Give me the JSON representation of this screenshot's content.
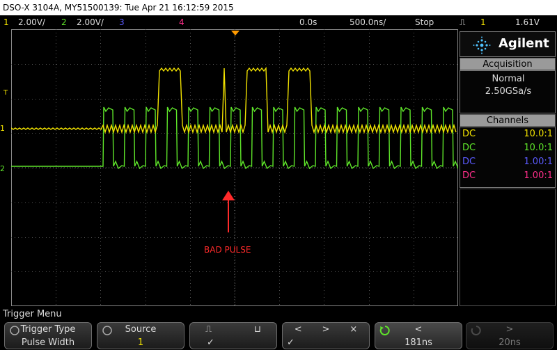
{
  "title_bar": "DSO-X 3104A, MY51500139: Tue Apr 21 16:12:59 2015",
  "status": {
    "ch1_num": "1",
    "ch1_scale": "2.00V/",
    "ch2_num": "2",
    "ch2_scale": "2.00V/",
    "ch3_num": "3",
    "ch4_num": "4",
    "delay": "0.0s",
    "timebase": "500.0ns/",
    "run_state": "Stop",
    "trig_src": "1",
    "trig_level": "1.61V"
  },
  "brand": "Agilent",
  "acquisition": {
    "title": "Acquisition",
    "mode": "Normal",
    "rate": "2.50GSa/s"
  },
  "channels": {
    "title": "Channels",
    "rows": [
      {
        "coupling": "DC",
        "ratio": "10.0:1",
        "color": "#f2e200"
      },
      {
        "coupling": "DC",
        "ratio": "10.0:1",
        "color": "#5fe62a"
      },
      {
        "coupling": "DC",
        "ratio": "1.00:1",
        "color": "#5b5bff"
      },
      {
        "coupling": "DC",
        "ratio": "1.00:1",
        "color": "#ff2e8a"
      }
    ]
  },
  "annotation": "BAD PULSE",
  "markers": {
    "trigger": "T",
    "ch1": "1",
    "ch2": "2"
  },
  "menu_title": "Trigger Menu",
  "softkeys": {
    "trigger_type_label": "Trigger Type",
    "trigger_type_value": "Pulse Width",
    "source_label": "Source",
    "source_value": "1",
    "polarity_value": "✓",
    "qual_value": "✓",
    "time_value": "181ns",
    "time2_value": "20ns"
  },
  "colors": {
    "ch1": "#f2e200",
    "ch2": "#5fe62a",
    "ch3": "#5b5bff",
    "ch4": "#ff2e8a",
    "annotation": "#ff2a2a"
  }
}
